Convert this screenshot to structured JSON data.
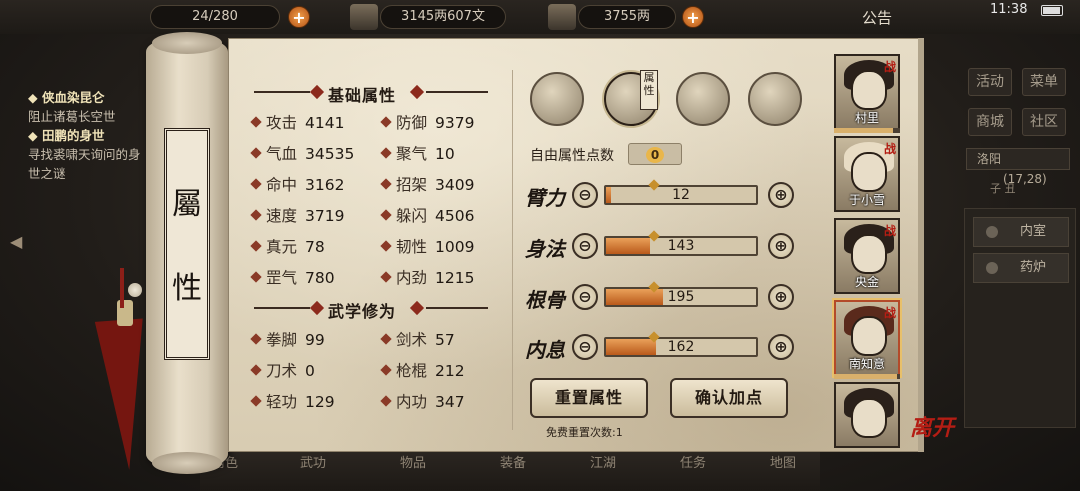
{
  "topbar": {
    "capacity": "24/280",
    "copper": "3145两607文",
    "silver": "3755两",
    "notice": "公告",
    "clock": "11:38",
    "plus": "+"
  },
  "quests": [
    {
      "title": "侠血染昆仑",
      "desc": "阻止诸葛长空​世"
    },
    {
      "title": "田鹏的身世",
      "desc": "寻找裘啸天询问的身世之谜"
    }
  ],
  "right_menu": {
    "buttons": [
      "活动",
      "菜单",
      "商城",
      "社区"
    ],
    "location": "洛阳",
    "location_coord": "(17,28)",
    "time_label": "子 丑",
    "list": [
      "内室",
      "药炉"
    ]
  },
  "scroll": {
    "title_chars": [
      "屬",
      "性"
    ]
  },
  "basic": {
    "header": "基础属性",
    "stats": [
      {
        "name": "攻击",
        "value": "4141"
      },
      {
        "name": "防御",
        "value": "9379"
      },
      {
        "name": "气血",
        "value": "34535"
      },
      {
        "name": "聚气",
        "value": "10"
      },
      {
        "name": "命中",
        "value": "3162"
      },
      {
        "name": "招架",
        "value": "3409"
      },
      {
        "name": "速度",
        "value": "3719"
      },
      {
        "name": "躲闪",
        "value": "4506"
      },
      {
        "name": "真元",
        "value": "78"
      },
      {
        "name": "韧性",
        "value": "1009"
      },
      {
        "name": "罡气",
        "value": "780"
      },
      {
        "name": "内劲",
        "value": "1215"
      }
    ]
  },
  "martial": {
    "header": "武学修为",
    "stats": [
      {
        "name": "拳脚",
        "value": "99"
      },
      {
        "name": "剑术",
        "value": "57"
      },
      {
        "name": "刀术",
        "value": "0"
      },
      {
        "name": "枪棍",
        "value": "212"
      },
      {
        "name": "轻功",
        "value": "129"
      },
      {
        "name": "内功",
        "value": "347"
      }
    ]
  },
  "attributes": {
    "category_tag": "属性",
    "free_points_label": "自由属性点数",
    "free_points": "0",
    "rows": [
      {
        "label": "臂力",
        "value": 12,
        "fill": 0.03
      },
      {
        "label": "身法",
        "value": 143,
        "fill": 0.29
      },
      {
        "label": "根骨",
        "value": 195,
        "fill": 0.38
      },
      {
        "label": "内息",
        "value": 162,
        "fill": 0.33
      }
    ],
    "minus": "⊖",
    "plus": "⊕",
    "reset_button": "重置属性",
    "confirm_button": "确认加点",
    "free_reset": "免费重置次数:1"
  },
  "companions": [
    {
      "name": "村里",
      "tag": "战",
      "hp": 0.9
    },
    {
      "name": "于小雪",
      "tag": "战"
    },
    {
      "name": "央金",
      "tag": "战"
    },
    {
      "name": "南知意",
      "tag": "战",
      "hp": 0.95
    },
    {
      "name": "",
      "tag": ""
    }
  ],
  "leave": "离开",
  "bottom_nav": [
    "角色",
    "武功",
    "物品",
    "装备",
    "江湖",
    "任务",
    "地图"
  ]
}
